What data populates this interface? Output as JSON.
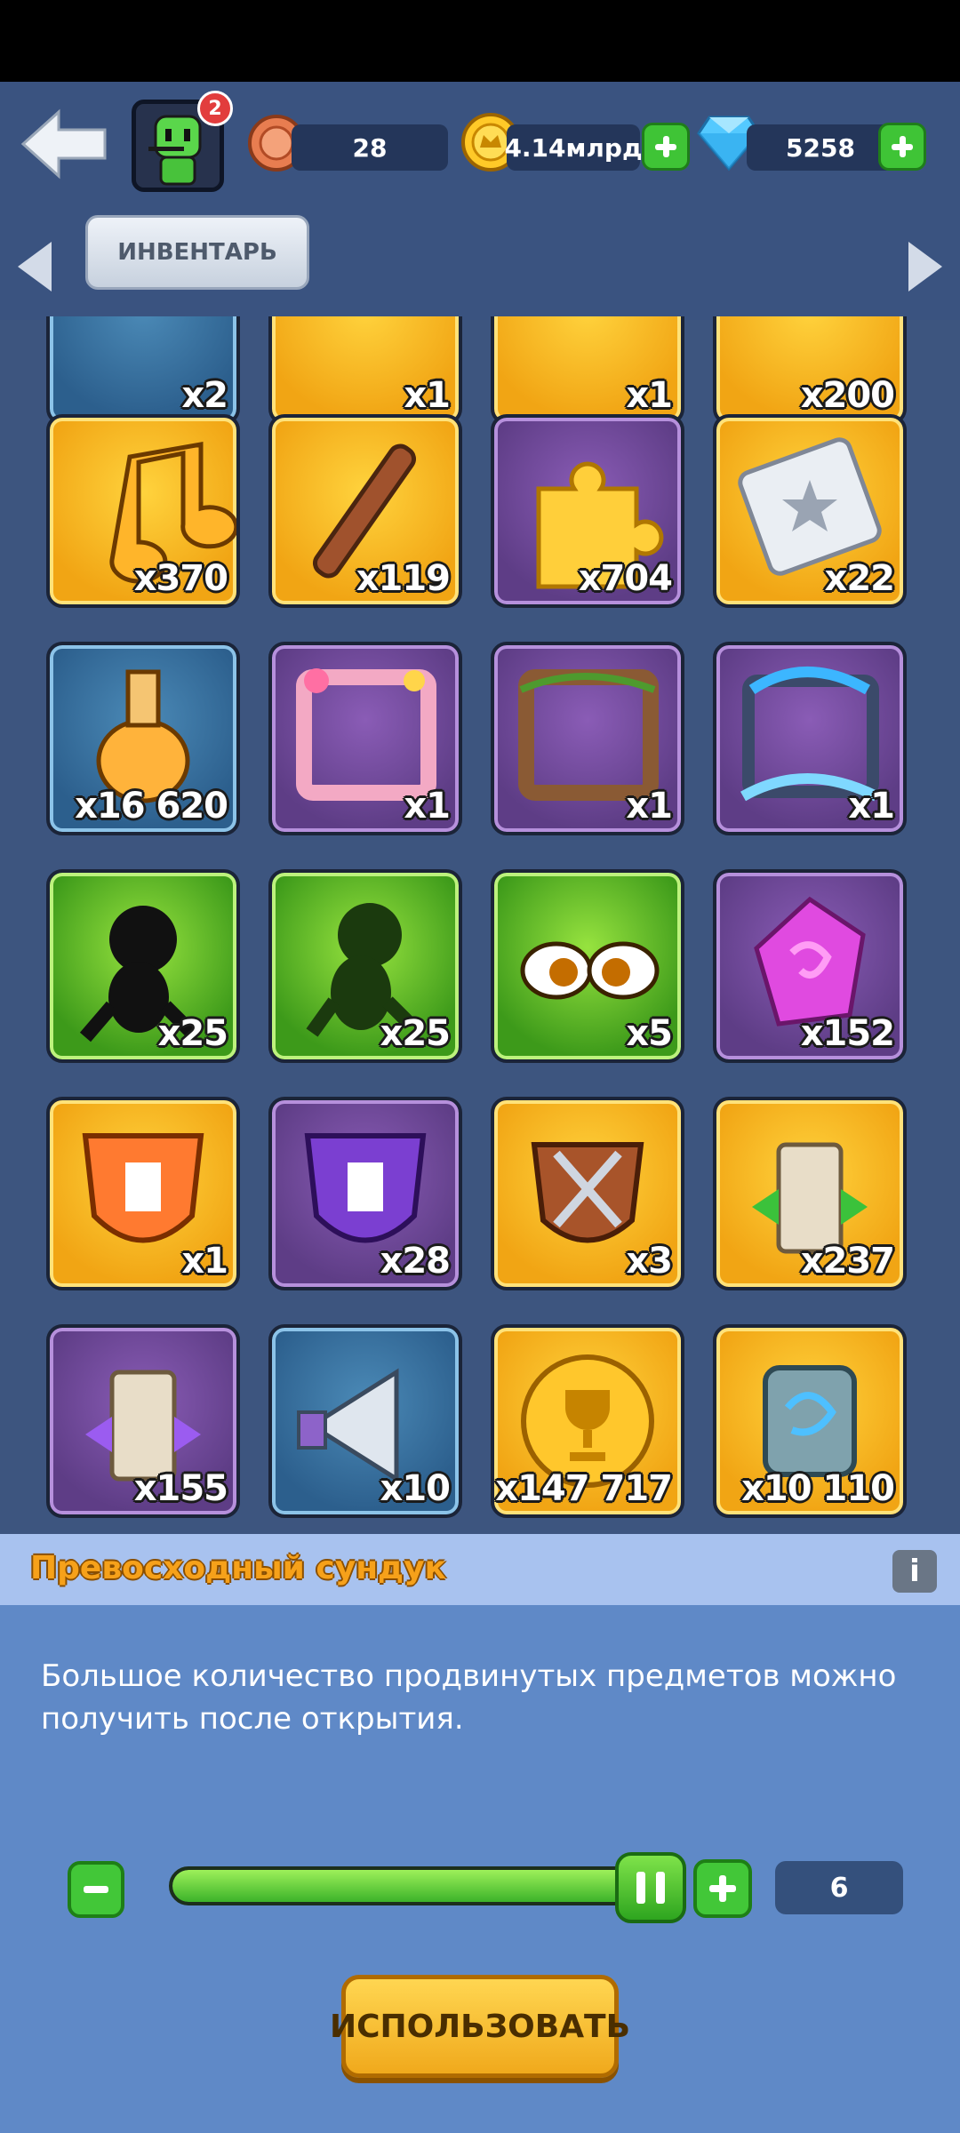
{
  "header": {
    "avatar_badge": "2",
    "tokens": "28",
    "gold": "4.14млрд",
    "gems": "5258"
  },
  "tabs": {
    "active": "ИНВЕНТАРЬ"
  },
  "grid": [
    {
      "name": "castle-item",
      "qty": "x2",
      "color": "blue"
    },
    {
      "name": "palace-item",
      "qty": "x1",
      "color": "gold"
    },
    {
      "name": "crown-item",
      "qty": "x1",
      "color": "gold"
    },
    {
      "name": "badge-item",
      "qty": "x200",
      "color": "gold"
    },
    {
      "name": "music-note-item",
      "qty": "x370",
      "color": "gold"
    },
    {
      "name": "flute-item",
      "qty": "x119",
      "color": "gold"
    },
    {
      "name": "puzzle-piece-item",
      "qty": "x704",
      "color": "purple"
    },
    {
      "name": "star-ticket-item",
      "qty": "x22",
      "color": "gold"
    },
    {
      "name": "potion-bottle-item",
      "qty": "x16 620",
      "color": "blue"
    },
    {
      "name": "flower-frame-item",
      "qty": "x1",
      "color": "purple"
    },
    {
      "name": "vine-frame-item",
      "qty": "x1",
      "color": "purple"
    },
    {
      "name": "octopus-frame-item",
      "qty": "x1",
      "color": "purple"
    },
    {
      "name": "runner-speed-item",
      "qty": "x25",
      "color": "green"
    },
    {
      "name": "runner-jump-item",
      "qty": "x25",
      "color": "green"
    },
    {
      "name": "angry-eyes-item",
      "qty": "x5",
      "color": "green"
    },
    {
      "name": "pink-gem-item",
      "qty": "x152",
      "color": "purple"
    },
    {
      "name": "orange-tower-shield-item",
      "qty": "x1",
      "color": "gold"
    },
    {
      "name": "purple-tower-shield-item",
      "qty": "x28",
      "color": "purple"
    },
    {
      "name": "crossed-swords-shield-item",
      "qty": "x3",
      "color": "gold"
    },
    {
      "name": "green-tower-item",
      "qty": "x237",
      "color": "gold"
    },
    {
      "name": "purple-tower-item",
      "qty": "x155",
      "color": "purple"
    },
    {
      "name": "megaphone-item",
      "qty": "x10",
      "color": "blue"
    },
    {
      "name": "trophy-coin-item",
      "qty": "x147 717",
      "color": "gold"
    },
    {
      "name": "dragon-rune-item",
      "qty": "x10 110",
      "color": "gold"
    }
  ],
  "details": {
    "title": "Превосходный сундук",
    "info_label": "i",
    "description": "Большое количество продвинутых предметов можно получить после открытия.",
    "selected_count": "6",
    "slider_fraction": 1.0,
    "use_label": "ИСПОЛЬЗОВАТЬ"
  }
}
